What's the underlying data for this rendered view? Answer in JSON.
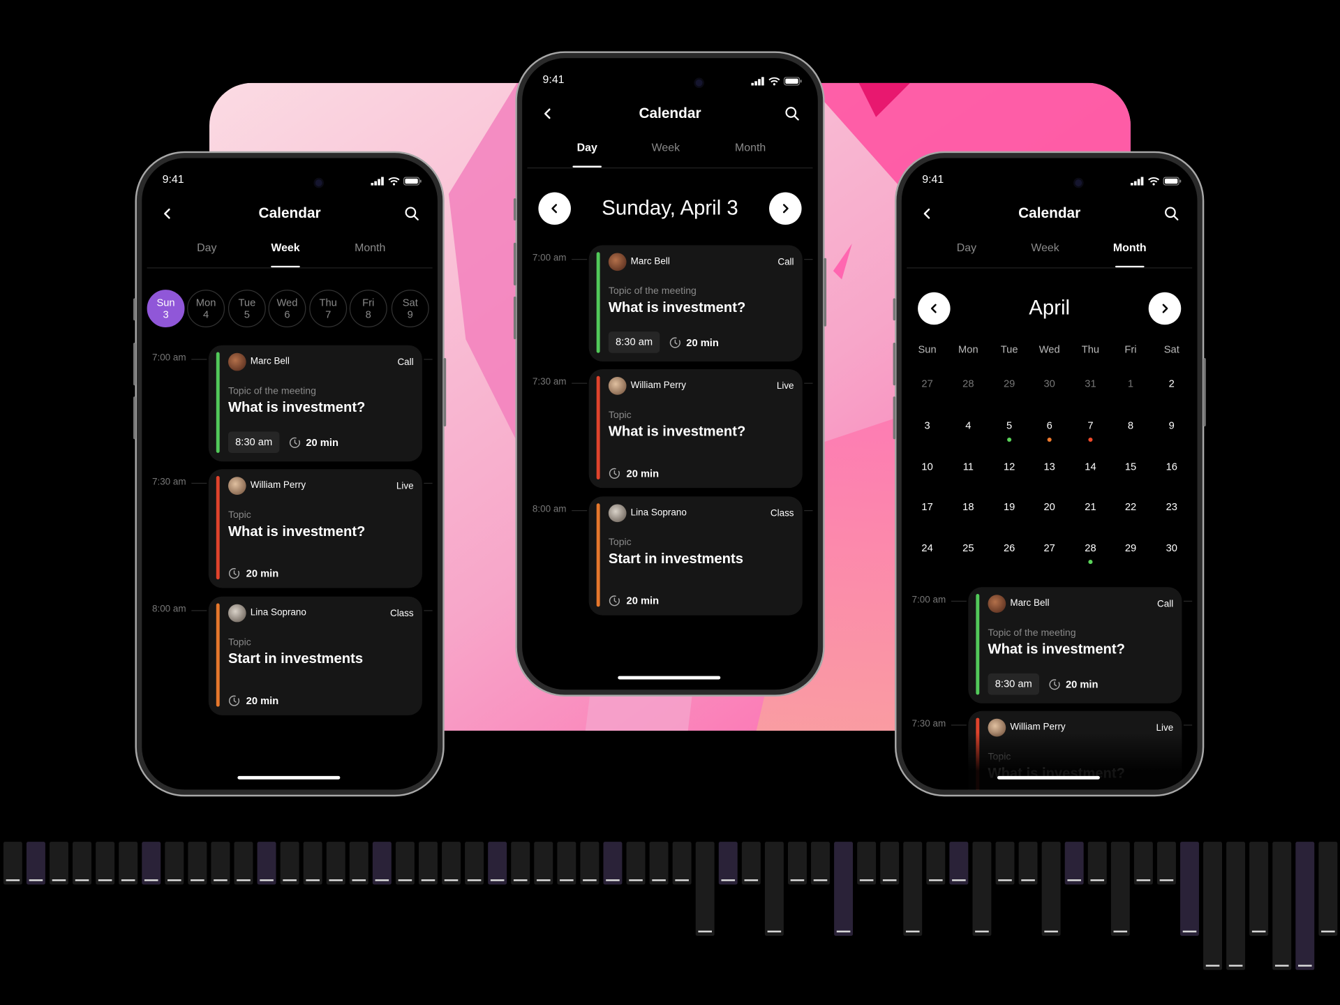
{
  "colors": {
    "accent": "#9057d8",
    "call": "#52c95a",
    "live": "#e0432c",
    "class": "#e5772c",
    "dot_green": "#5ad35a",
    "dot_orange": "#ef7a2e",
    "dot_red": "#ef4a2a"
  },
  "status": {
    "time": "9:41",
    "icons": [
      "signal-icon",
      "wifi-icon",
      "battery-icon"
    ]
  },
  "header": {
    "title": "Calendar",
    "back_icon": "chevron-left-icon",
    "search_icon": "search-icon"
  },
  "tabs": [
    "Day",
    "Week",
    "Month"
  ],
  "week_view": {
    "active_tab": "Week",
    "days": [
      {
        "dow": "Sun",
        "date": "3",
        "selected": true
      },
      {
        "dow": "Mon",
        "date": "4"
      },
      {
        "dow": "Tue",
        "date": "5"
      },
      {
        "dow": "Wed",
        "date": "6"
      },
      {
        "dow": "Thu",
        "date": "7"
      },
      {
        "dow": "Fri",
        "date": "8"
      },
      {
        "dow": "Sat",
        "date": "9"
      }
    ]
  },
  "day_view": {
    "active_tab": "Day",
    "date_title": "Sunday, April 3"
  },
  "month_view": {
    "active_tab": "Month",
    "month": "April",
    "weekdays": [
      "Sun",
      "Mon",
      "Tue",
      "Wed",
      "Thu",
      "Fri",
      "Sat"
    ],
    "weeks": [
      [
        {
          "d": "27",
          "muted": true
        },
        {
          "d": "28",
          "muted": true
        },
        {
          "d": "29",
          "muted": true
        },
        {
          "d": "30",
          "muted": true
        },
        {
          "d": "31",
          "muted": true
        },
        {
          "d": "1",
          "muted": true
        },
        {
          "d": "2"
        }
      ],
      [
        {
          "d": "3"
        },
        {
          "d": "4"
        },
        {
          "d": "5",
          "dot": "green"
        },
        {
          "d": "6",
          "dot": "orange"
        },
        {
          "d": "7",
          "dot": "red"
        },
        {
          "d": "8"
        },
        {
          "d": "9"
        }
      ],
      [
        {
          "d": "10"
        },
        {
          "d": "11"
        },
        {
          "d": "12"
        },
        {
          "d": "13"
        },
        {
          "d": "14"
        },
        {
          "d": "15"
        },
        {
          "d": "16"
        }
      ],
      [
        {
          "d": "17"
        },
        {
          "d": "18"
        },
        {
          "d": "19"
        },
        {
          "d": "20"
        },
        {
          "d": "21"
        },
        {
          "d": "22"
        },
        {
          "d": "23"
        }
      ],
      [
        {
          "d": "24"
        },
        {
          "d": "25"
        },
        {
          "d": "26"
        },
        {
          "d": "27"
        },
        {
          "d": "28",
          "dot": "green"
        },
        {
          "d": "29"
        },
        {
          "d": "30"
        }
      ]
    ]
  },
  "events": [
    {
      "time": "7:00 am",
      "name": "Marc Bell",
      "type": "Call",
      "topic_label": "Topic of the meeting",
      "title": "What is investment?",
      "start": "8:30 am",
      "duration": "20 min",
      "color": "call"
    },
    {
      "time": "7:30 am",
      "name": "William Perry",
      "type": "Live",
      "topic_label": "Topic",
      "title": "What is investment?",
      "duration": "20 min",
      "color": "live"
    },
    {
      "time": "8:00 am",
      "name": "Lina Soprano",
      "type": "Class",
      "topic_label": "Topic",
      "title": "Start in investments",
      "duration": "20 min",
      "color": "class"
    }
  ]
}
